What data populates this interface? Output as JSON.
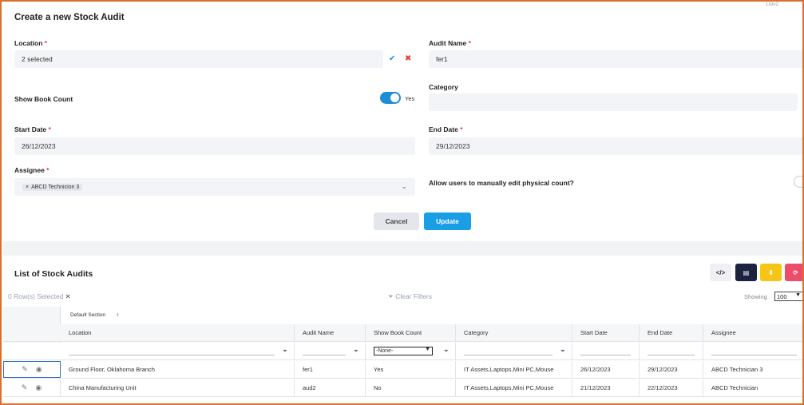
{
  "corner_text": "Listv2",
  "form": {
    "title": "Create a new Stock Audit",
    "location": {
      "label": "Location",
      "value": "2 selected"
    },
    "audit_name": {
      "label": "Audit Name",
      "value": "fer1"
    },
    "show_book_count": {
      "label": "Show Book Count",
      "toggle_text": "Yes",
      "on": true
    },
    "category": {
      "label": "Category",
      "value": ""
    },
    "start_date": {
      "label": "Start Date",
      "value": "26/12/2023"
    },
    "end_date": {
      "label": "End Date",
      "value": "29/12/2023"
    },
    "assignee": {
      "label": "Assignee",
      "chip": "ABCD Technicion 3"
    },
    "allow_edit": {
      "label": "Allow users to manually edit physical count?"
    },
    "required_mark": "*",
    "cancel_label": "Cancel",
    "update_label": "Update"
  },
  "list": {
    "title": "List of Stock Audits",
    "rows_selected": "0 Row(s) Selected",
    "clear_filters": "Clear Filters",
    "showing_label": "Showing",
    "showing_value": "100",
    "section_label": "Default Section",
    "filter_select": "-None-",
    "columns": [
      "Location",
      "Audit Name",
      "Show Book Count",
      "Category",
      "Start Date",
      "End Date",
      "Assignee"
    ],
    "rows": [
      [
        "Ground Floor, Oklahoma Branch",
        "fer1",
        "Yes",
        "IT Assets,Laptops,Mini PC,Mouse",
        "26/12/2023",
        "29/12/2023",
        "ABCD Technician 3"
      ],
      [
        "China Manufacturing Unit",
        "aud2",
        "No",
        "IT Assets,Laptops,Mini PC,Mouse",
        "21/12/2023",
        "22/12/2023",
        "ABCD Technician"
      ]
    ]
  },
  "colors": {
    "accent": "#1a9ee6",
    "border": "#d9712c",
    "danger": "#e53935"
  }
}
